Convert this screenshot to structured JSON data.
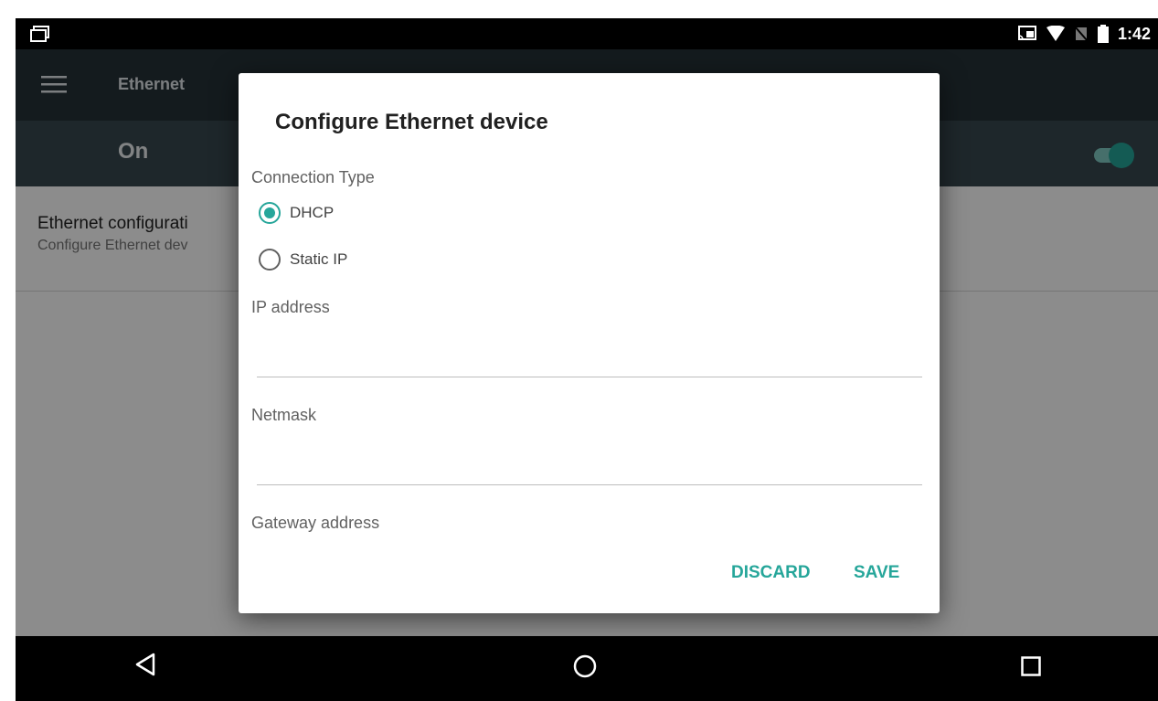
{
  "status_bar": {
    "clock": "1:42",
    "icons": [
      "cast-icon",
      "wifi-icon",
      "no-sim-icon",
      "battery-icon"
    ]
  },
  "toolbar": {
    "title": "Ethernet"
  },
  "switch_bar": {
    "label": "On",
    "enabled": true
  },
  "list": {
    "item_title": "Ethernet configurati",
    "item_subtitle": "Configure Ethernet dev"
  },
  "dialog": {
    "title": "Configure Ethernet device",
    "connection_type_label": "Connection Type",
    "options": [
      {
        "label": "DHCP",
        "selected": true
      },
      {
        "label": "Static IP",
        "selected": false
      }
    ],
    "fields": {
      "ip_label": "IP address",
      "ip_value": "",
      "netmask_label": "Netmask",
      "netmask_value": "",
      "gateway_label": "Gateway address"
    },
    "buttons": {
      "discard": "DISCARD",
      "save": "SAVE"
    }
  },
  "colors": {
    "accent": "#26a69a",
    "toolbar": "#263238",
    "switch_bar": "#37474f"
  }
}
